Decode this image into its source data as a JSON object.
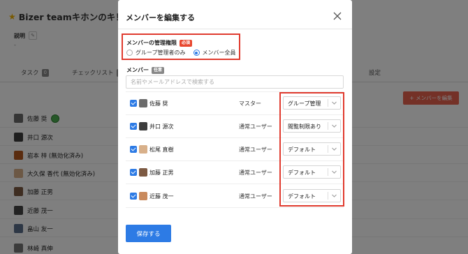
{
  "background": {
    "title": "Bizer teamキホンのキ！",
    "desc_label": "説明",
    "desc_value": "-",
    "tabs": [
      {
        "label": "タスク",
        "count": "0"
      },
      {
        "label": "チェックリスト",
        "count": "0"
      }
    ],
    "right_tab": "設定",
    "edit_members_label": "+ メンバーを編集",
    "members": [
      {
        "name": "佐藤 奨"
      },
      {
        "name": "井口 源次"
      },
      {
        "name": "岩本 梓 (無効化済み)"
      },
      {
        "name": "大久保 香代 (無効化済み)"
      },
      {
        "name": "加藤 正男"
      },
      {
        "name": "近藤 茂一"
      },
      {
        "name": "畠山 友一"
      },
      {
        "name": "林崎 真伸"
      }
    ]
  },
  "modal": {
    "title": "メンバーを編集する",
    "permission": {
      "label": "メンバーの管理権限",
      "required": "必須",
      "options": [
        "グループ管理者のみ",
        "メンバー全員"
      ],
      "selected": 1
    },
    "members_section": {
      "label": "メンバー",
      "optional": "任意",
      "search_placeholder": "名前やメールアドレスで検索する"
    },
    "rows": [
      {
        "name": "佐藤 奨",
        "role": "マスター",
        "permission": "グループ管理"
      },
      {
        "name": "井口 源次",
        "role": "通常ユーザー",
        "permission": "閲覧制限あり"
      },
      {
        "name": "松尾 直樹",
        "role": "通常ユーザー",
        "permission": "デフォルト"
      },
      {
        "name": "加藤 正男",
        "role": "通常ユーザー",
        "permission": "デフォルト"
      },
      {
        "name": "近藤 茂一",
        "role": "通常ユーザー",
        "permission": "デフォルト"
      }
    ],
    "save_label": "保存する"
  },
  "colors": {
    "accent": "#2d7be5",
    "highlight": "#e03a2e",
    "required_badge": "#e8472f"
  }
}
